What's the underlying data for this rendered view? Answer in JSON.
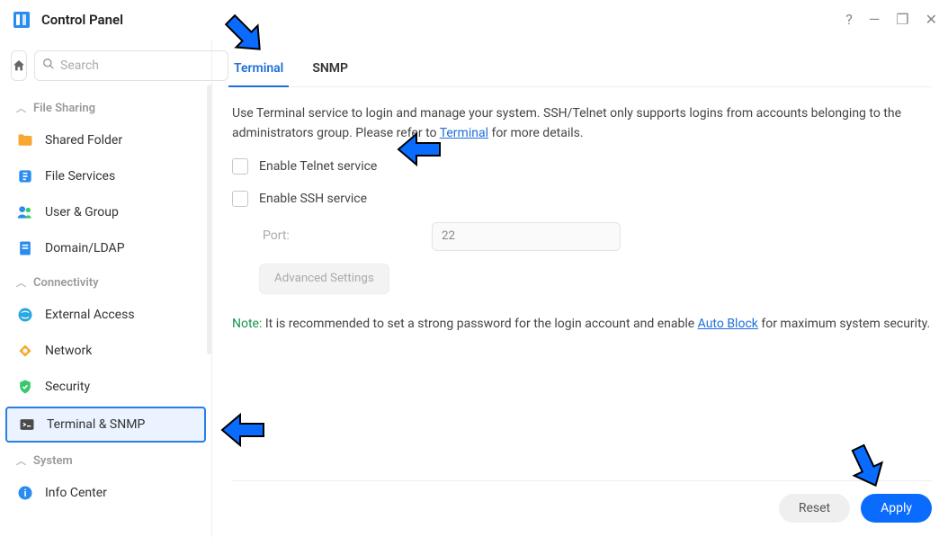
{
  "window": {
    "title": "Control Panel",
    "help": "?",
    "min": "—",
    "max": "❐",
    "close": "✕"
  },
  "search": {
    "placeholder": "Search"
  },
  "sidebar": {
    "groups": {
      "file_sharing": "File Sharing",
      "connectivity": "Connectivity",
      "system": "System"
    },
    "items": {
      "shared_folder": "Shared Folder",
      "file_services": "File Services",
      "user_group": "User & Group",
      "domain_ldap": "Domain/LDAP",
      "external_access": "External Access",
      "network": "Network",
      "security": "Security",
      "terminal_snmp": "Terminal & SNMP",
      "info_center": "Info Center"
    }
  },
  "tabs": {
    "terminal": "Terminal",
    "snmp": "SNMP"
  },
  "content": {
    "intro_1": "Use Terminal service to login and manage your system. SSH/Telnet only supports logins from accounts belonging to the administrators group. Please refer to ",
    "intro_link": "Terminal",
    "intro_2": " for more details.",
    "enable_telnet": "Enable Telnet service",
    "enable_ssh": "Enable SSH service",
    "port_label": "Port:",
    "port_value": "22",
    "adv_btn": "Advanced Settings",
    "note_prefix": "Note:",
    "note_1": " It is recommended to set a strong password for the login account and enable ",
    "note_link": "Auto Block",
    "note_2": " for maximum system security."
  },
  "footer": {
    "reset": "Reset",
    "apply": "Apply"
  },
  "colors": {
    "accent": "#0a6cff",
    "link": "#1e6fd9",
    "note": "#16954b"
  }
}
